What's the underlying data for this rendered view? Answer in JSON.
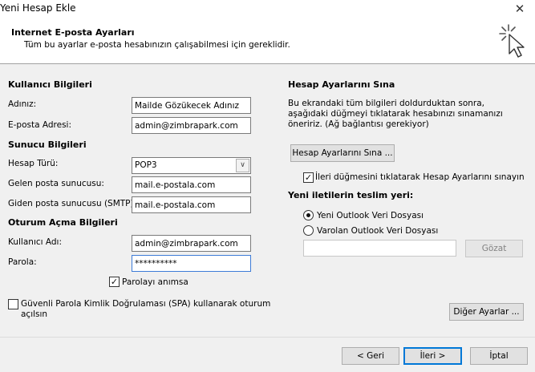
{
  "window": {
    "title": "Yeni Hesap Ekle",
    "close_label": "✕"
  },
  "header": {
    "title": "Internet E-posta Ayarları",
    "subtitle": "Tüm bu ayarlar e-posta hesabınızın çalışabilmesi için gereklidir."
  },
  "user_info": {
    "section_title": "Kullanıcı Bilgileri",
    "name_label": "Adınız:",
    "name_value": "Mailde Gözükecek Adınız",
    "email_label": "E-posta Adresi:",
    "email_value": "admin@zimbrapark.com"
  },
  "server_info": {
    "section_title": "Sunucu Bilgileri",
    "account_type_label": "Hesap Türü:",
    "account_type_value": "POP3",
    "incoming_label": "Gelen posta sunucusu:",
    "incoming_value": "mail.e-postala.com",
    "outgoing_label": "Giden posta sunucusu (SMTP):",
    "outgoing_value": "mail.e-postala.com"
  },
  "logon_info": {
    "section_title": "Oturum Açma Bilgileri",
    "username_label": "Kullanıcı Adı:",
    "username_value": "admin@zimbrapark.com",
    "password_label": "Parola:",
    "password_value": "**********",
    "remember_label": "Parolayı anımsa",
    "remember_checked": true,
    "spa_label_line1": "Güvenli Parola Kimlik Doğrulaması (SPA) kullanarak oturum",
    "spa_label_line2": "açılsın",
    "spa_checked": false
  },
  "test_settings": {
    "section_title": "Hesap Ayarlarını Sına",
    "description": "Bu ekrandaki tüm bilgileri doldurduktan sonra, aşağıdaki düğmeyi tıklatarak hesabınızı sınamanızı öneririz. (Ağ bağlantısı gerekiyor)",
    "test_button": "Hesap Ayarlarını Sına ...",
    "auto_test_label": "İleri düğmesini tıklatarak Hesap Ayarlarını sınayın",
    "auto_test_checked": true
  },
  "delivery": {
    "section_title": "Yeni iletilerin teslim yeri:",
    "new_pst_label": "Yeni Outlook Veri Dosyası",
    "existing_pst_label": "Varolan Outlook Veri Dosyası",
    "existing_path_value": "",
    "browse_button": "Gözat",
    "selected": "new"
  },
  "buttons": {
    "more_settings": "Diğer Ayarlar ...",
    "back": "< Geri",
    "next": "İleri >",
    "cancel": "İptal"
  },
  "icons": {
    "header_icon": "cursor-click-icon",
    "checkmark": "✓"
  },
  "colors": {
    "focus_border": "#3d7bd7",
    "default_button": "#0078d7"
  }
}
